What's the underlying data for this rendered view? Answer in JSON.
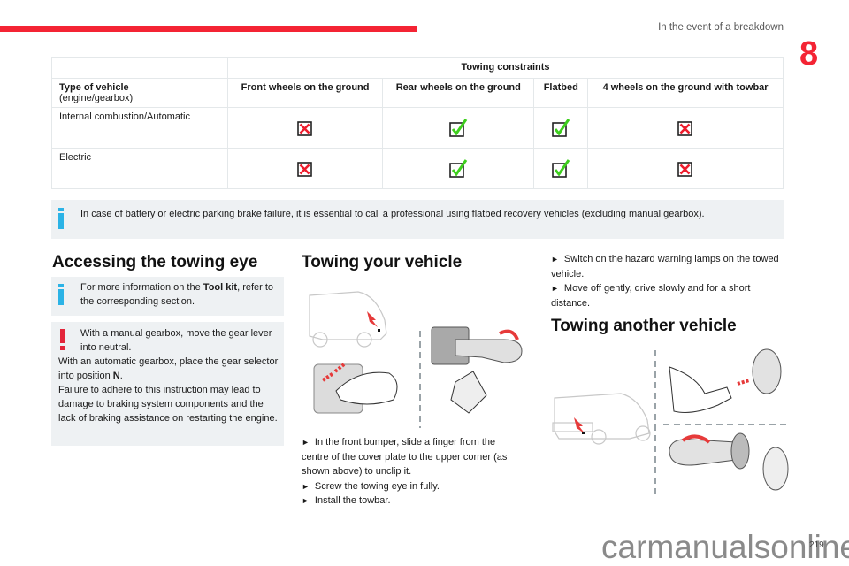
{
  "header": {
    "title": "In the event of a breakdown",
    "chapter": "8",
    "accent_color": "#f42434"
  },
  "table": {
    "group_header": "Towing constraints",
    "type_header": "Type of vehicle",
    "type_subheader": "(engine/gearbox)",
    "columns": [
      "Front wheels on the ground",
      "Rear wheels on the ground",
      "Flatbed",
      "4 wheels on the ground with towbar"
    ],
    "rows": [
      {
        "label": "Internal combustion/Automatic",
        "values": [
          "not-allowed",
          "allowed",
          "allowed",
          "not-allowed"
        ]
      },
      {
        "label": "Electric",
        "values": [
          "not-allowed",
          "allowed",
          "allowed",
          "not-allowed"
        ]
      }
    ],
    "icons": {
      "allowed": "green-check-icon",
      "not-allowed": "red-cross-icon"
    }
  },
  "notice_battery": {
    "icon": "info-icon",
    "text": "In case of battery or electric parking brake failure, it is essential to call a professional using flatbed recovery vehicles (excluding manual gearbox)."
  },
  "access": {
    "title": "Accessing the towing eye",
    "info_pre": "For more information on the ",
    "info_bold": "Tool kit",
    "info_post": ", refer to the corresponding section.",
    "warn_icon": "warning-icon",
    "warn_line1": "With a manual gearbox, move the gear lever into neutral.",
    "warn_line2_pre": "With an automatic gearbox, place the gear selector into position ",
    "warn_line2_bold": "N",
    "warn_line2_post": ".",
    "warn_line3": "Failure to adhere to this instruction may lead to damage to braking system components and the lack of braking assistance on restarting the engine."
  },
  "tow_yours": {
    "title": "Towing your vehicle",
    "steps": [
      "In the front bumper, slide a finger from the centre of the cover plate to the upper corner (as shown above) to unclip it.",
      "Screw the towing eye in fully.",
      "Install the towbar."
    ]
  },
  "right_col": {
    "steps": [
      "Switch on the hazard warning lamps on the towed vehicle.",
      "Move off gently, drive slowly and for a short distance."
    ],
    "tow_another_title": "Towing another vehicle"
  },
  "footer": {
    "watermark": "carmanualsonline.info",
    "page_number": "219"
  }
}
